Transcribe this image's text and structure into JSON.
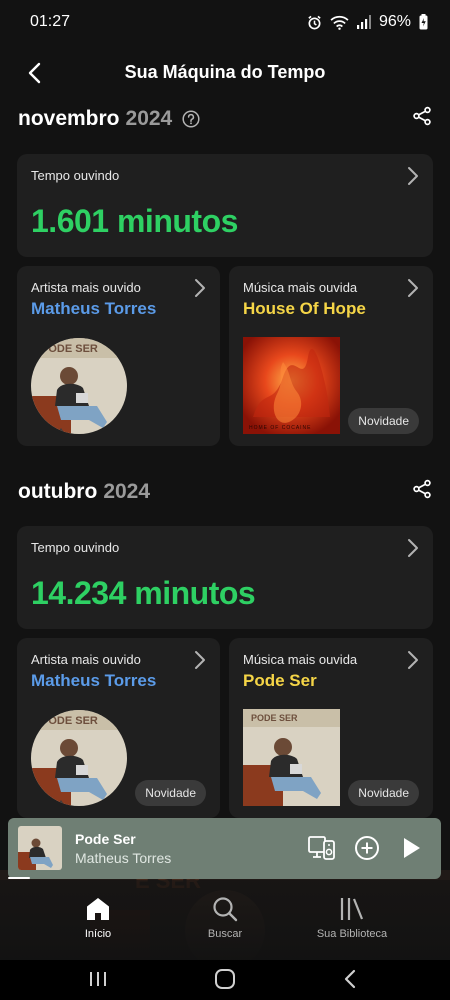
{
  "status": {
    "time": "01:27",
    "battery": "96%"
  },
  "header": {
    "title": "Sua Máquina do Tempo"
  },
  "sections": [
    {
      "month": "novembro",
      "year": "2024",
      "listen_label": "Tempo ouvindo",
      "minutes": "1.601 minutos",
      "artist_label": "Artista mais ouvido",
      "artist_name": "Matheus Torres",
      "song_label": "Música mais ouvida",
      "song_name": "House Of Hope",
      "song_badge": "Novidade"
    },
    {
      "month": "outubro",
      "year": "2024",
      "listen_label": "Tempo ouvindo",
      "minutes": "14.234 minutos",
      "artist_label": "Artista mais ouvido",
      "artist_name": "Matheus Torres",
      "artist_badge": "Novidade",
      "song_label": "Música mais ouvida",
      "song_name": "Pode Ser",
      "song_badge": "Novidade"
    }
  ],
  "player": {
    "title": "Pode Ser",
    "artist": "Matheus Torres"
  },
  "nav": {
    "home": "Início",
    "search": "Buscar",
    "library": "Sua Biblioteca"
  },
  "colors": {
    "minutes": "#2ed063",
    "artist": "#5b9be8",
    "song": "#f5d547",
    "player_bg": "#6f7f74"
  }
}
